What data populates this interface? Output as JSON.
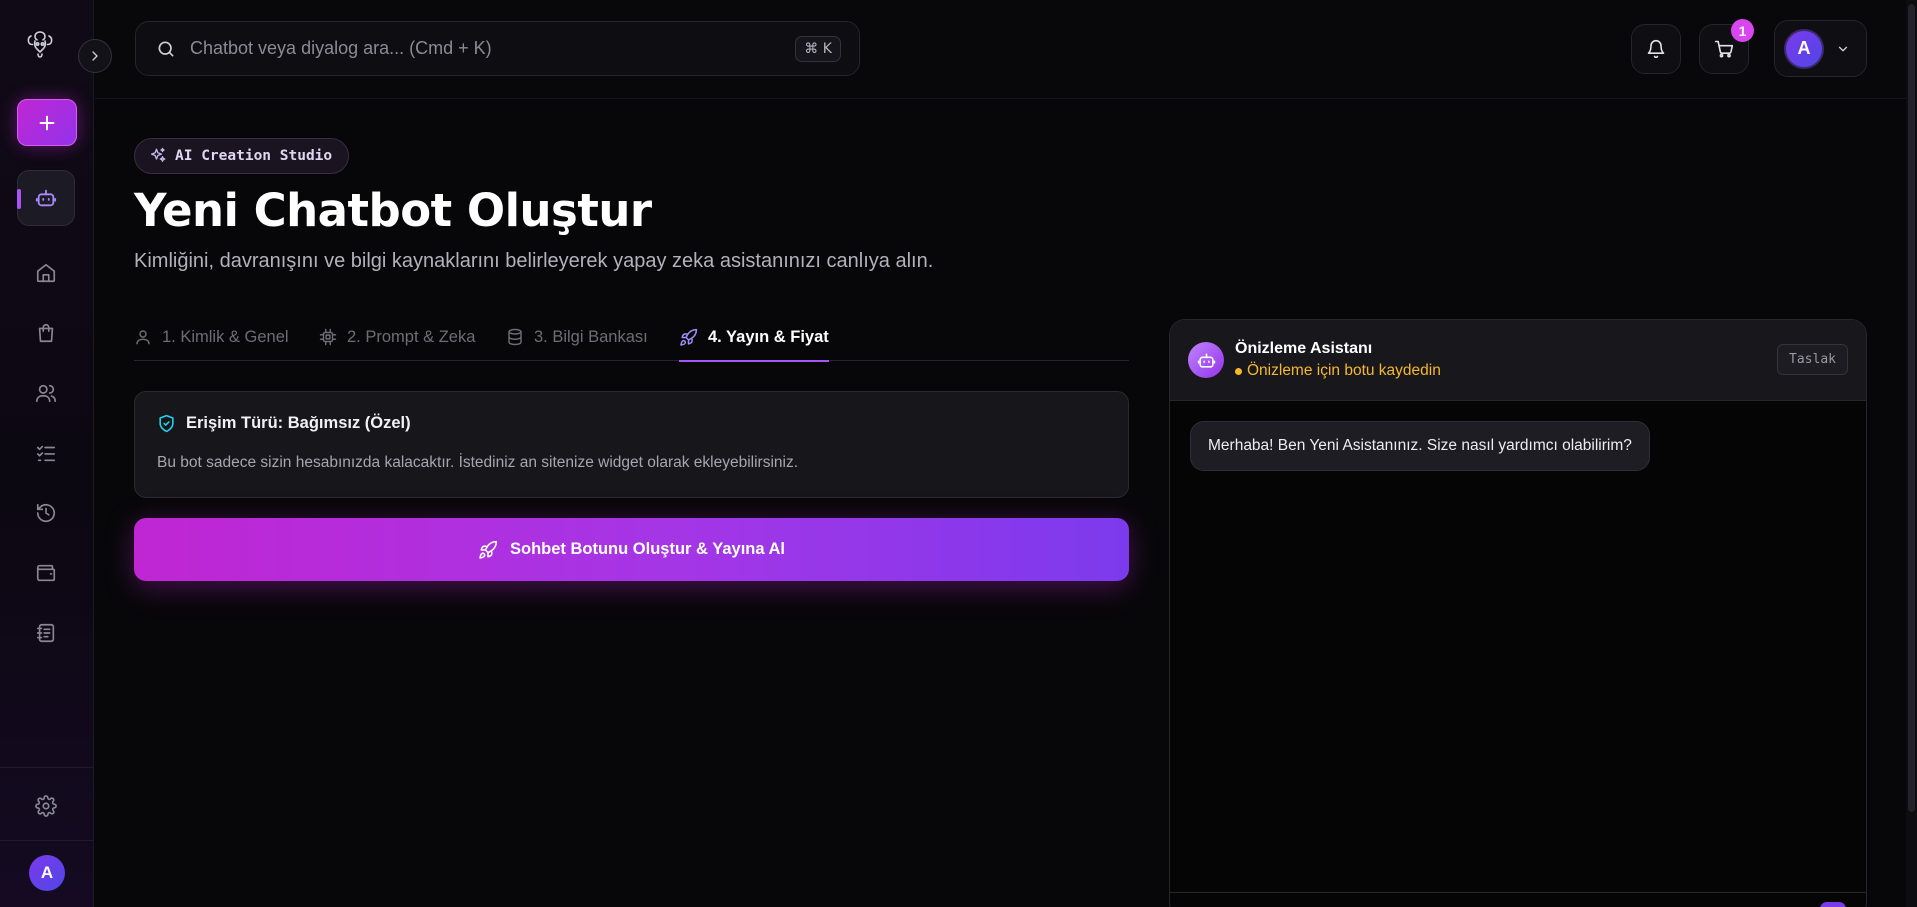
{
  "topbar": {
    "search_placeholder": "Chatbot veya diyalog ara... (Cmd + K)",
    "shortcut": "⌘ K",
    "cart_count": "1",
    "profile_initial": "A"
  },
  "sidebar": {
    "user_initial": "A",
    "nav_icons": [
      "home-icon",
      "shopping-bag-icon",
      "users-icon",
      "checklist-icon",
      "history-icon",
      "wallet-icon",
      "notebook-icon"
    ]
  },
  "page": {
    "badge": "AI Creation Studio",
    "title": "Yeni Chatbot Oluştur",
    "subtitle": "Kimliğini, davranışını ve bilgi kaynaklarını belirleyerek yapay zeka asistanınızı canlıya alın."
  },
  "tabs": [
    {
      "label": "1. Kimlik & Genel",
      "icon": "user-icon"
    },
    {
      "label": "2. Prompt & Zeka",
      "icon": "cpu-icon"
    },
    {
      "label": "3. Bilgi Bankası",
      "icon": "database-icon"
    },
    {
      "label": "4. Yayın & Fiyat",
      "icon": "rocket-icon",
      "active": true
    }
  ],
  "access": {
    "title": "Erişim Türü: Bağımsız (Özel)",
    "description": "Bu bot sadece sizin hesabınızda kalacaktır. İstediniz an sitenize widget olarak ekleyebilirsiniz."
  },
  "create_button": "Sohbet Botunu Oluştur & Yayına Al",
  "preview": {
    "title": "Önizleme Asistanı",
    "status": "Önizleme için botu kaydedin",
    "status_color": "#f5b82e",
    "draft": "Taslak",
    "message": "Merhaba! Ben Yeni Asistanınız. Size nasıl yardımcı olabilirim?"
  },
  "colors": {
    "accent": "#a855f7",
    "primary_gradient_start": "#c026d3",
    "primary_gradient_end": "#7c3aed",
    "shield": "#22d3ee"
  }
}
